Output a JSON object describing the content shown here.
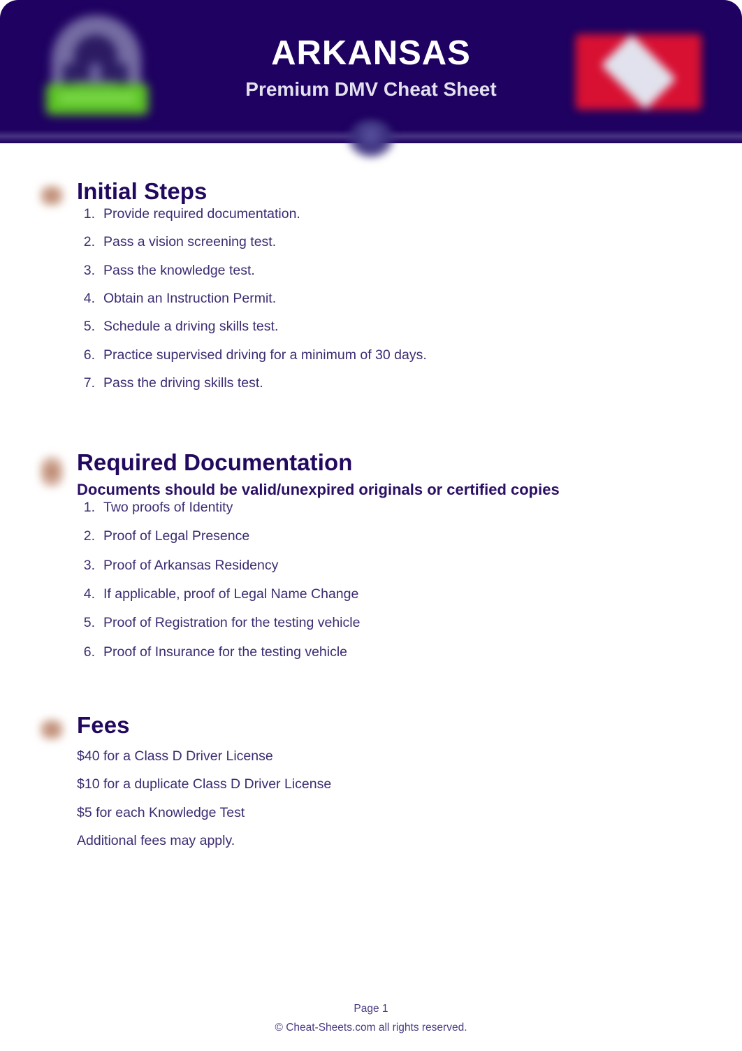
{
  "header": {
    "title": "ARKANSAS",
    "subtitle": "Premium DMV Cheat Sheet",
    "seal_icon": "state-seal-icon",
    "flag_icon": "arkansas-flag-icon",
    "background_color": "#1e0160",
    "title_color": "#ffffff",
    "subtitle_color": "#e2e0ec",
    "flag_field_color": "#e01131",
    "flag_diamond_color": "#e9ecf3",
    "seal_banner_color": "#5bc224"
  },
  "sections": [
    {
      "id": "initial-steps",
      "icon": "checklist-icon",
      "title": "Initial Steps",
      "subtitle": "",
      "items": [
        "Provide required documentation.",
        "Pass a vision screening test.",
        "Pass the knowledge test.",
        "Obtain an Instruction Permit.",
        "Schedule a driving skills test.",
        "Practice supervised driving for a minimum of 30 days.",
        "Pass the driving skills test."
      ]
    },
    {
      "id": "required-documentation",
      "icon": "document-icon",
      "title": "Required Documentation",
      "subtitle": "Documents should be valid/unexpired originals or certified copies",
      "items": [
        "Two proofs of Identity",
        "Proof of Legal Presence",
        "Proof of Arkansas Residency",
        "If applicable, proof of Legal Name Change",
        "Proof of Registration for the testing vehicle",
        "Proof of Insurance for the testing vehicle"
      ]
    },
    {
      "id": "fees",
      "icon": "money-icon",
      "title": "Fees",
      "subtitle": "",
      "items": [
        "$40 for a Class D Driver License",
        "$10 for a duplicate Class D Driver License",
        "$5 for each Knowledge Test",
        "Additional fees may apply."
      ]
    }
  ],
  "footer": {
    "page_number": "Page 1",
    "copyright": "©  Cheat-Sheets.com all rights reserved."
  },
  "theme": {
    "heading_color": "#22085e",
    "body_text_color": "#3c2c72",
    "footer_text_color": "#4b3c82",
    "page_background": "#ffffff",
    "section_icon_color": "#b0765c"
  }
}
